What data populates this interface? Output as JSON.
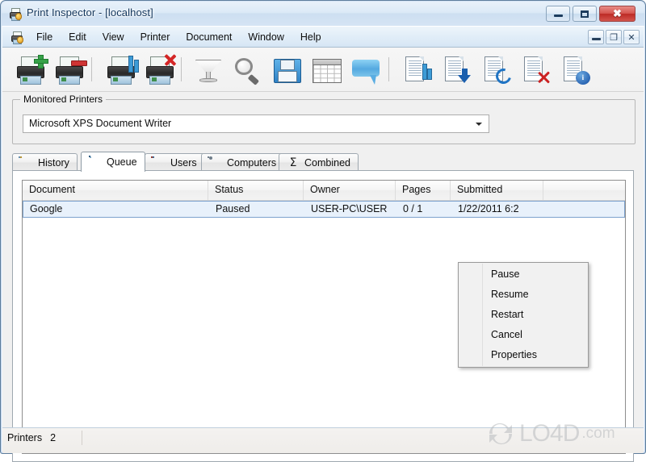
{
  "window": {
    "title": "Print Inspector - [localhost]",
    "app_icon": "printer-app-icon",
    "controls": {
      "minimize": "Minimize",
      "maximize": "Maximize",
      "close": "Close"
    },
    "mdi_controls": {
      "minimize": "Minimize Document",
      "restore": "Restore Document",
      "close": "Close Document"
    }
  },
  "menu": {
    "icon": "printer-app-icon",
    "items": [
      {
        "label": "File"
      },
      {
        "label": "Edit"
      },
      {
        "label": "View"
      },
      {
        "label": "Printer"
      },
      {
        "label": "Document"
      },
      {
        "label": "Window"
      },
      {
        "label": "Help"
      }
    ]
  },
  "toolbar": {
    "buttons": [
      {
        "name": "add-printer",
        "icon": "printer-add-icon",
        "title": "Add Printer"
      },
      {
        "name": "remove-printer",
        "icon": "printer-remove-icon",
        "title": "Remove Printer"
      },
      {
        "name": "printer-stats",
        "icon": "printer-stats-icon",
        "title": "Printer Statistics"
      },
      {
        "name": "delete-printer",
        "icon": "printer-delete-icon",
        "title": "Delete Printer"
      },
      {
        "name": "filter",
        "icon": "funnel-icon",
        "title": "Filter"
      },
      {
        "name": "search",
        "icon": "search-icon",
        "title": "Search"
      },
      {
        "name": "save",
        "icon": "save-icon",
        "title": "Save"
      },
      {
        "name": "grid",
        "icon": "table-icon",
        "title": "Grid"
      },
      {
        "name": "notify",
        "icon": "balloon-icon",
        "title": "Notifications"
      },
      {
        "name": "document-stats",
        "icon": "document-stats-icon",
        "title": "Document Statistics"
      },
      {
        "name": "document-download",
        "icon": "document-download-icon",
        "title": "Download Document"
      },
      {
        "name": "document-restart",
        "icon": "document-restart-icon",
        "title": "Restart Document"
      },
      {
        "name": "document-delete",
        "icon": "document-delete-icon",
        "title": "Delete Document"
      },
      {
        "name": "document-info",
        "icon": "document-info-icon",
        "title": "Document Info"
      }
    ]
  },
  "printers_group": {
    "legend": "Monitored Printers",
    "combo": {
      "selected": "Microsoft XPS Document Writer",
      "options": [
        "Microsoft XPS Document Writer"
      ]
    }
  },
  "tabs": [
    {
      "label": "History",
      "icon": "history-icon",
      "active": false
    },
    {
      "label": "Queue",
      "icon": "queue-icon",
      "active": true
    },
    {
      "label": "Users",
      "icon": "users-icon",
      "active": false
    },
    {
      "label": "Computers",
      "icon": "computers-icon",
      "active": false
    },
    {
      "label": "Combined",
      "icon": "sigma-icon",
      "active": false
    }
  ],
  "grid": {
    "columns": [
      "Document",
      "Status",
      "Owner",
      "Pages",
      "Submitted",
      ""
    ],
    "rows": [
      {
        "document": "Google",
        "status": "Paused",
        "owner": "USER-PC\\USER",
        "pages": "0 / 1",
        "submitted": "1/22/2011 6:2",
        "selected": true
      }
    ]
  },
  "context_menu": {
    "items": [
      {
        "label": "Pause"
      },
      {
        "label": "Resume"
      },
      {
        "label": "Restart"
      },
      {
        "label": "Cancel"
      },
      {
        "label": "Properties"
      }
    ]
  },
  "status_bar": {
    "label": "Printers",
    "value": "2"
  },
  "watermark": {
    "text": "LO4D",
    "suffix": ".com"
  }
}
